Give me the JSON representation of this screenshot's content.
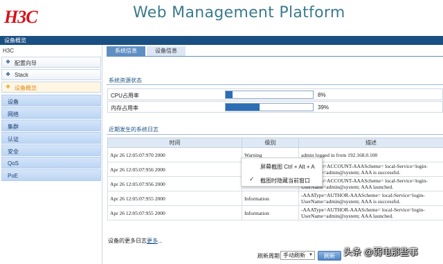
{
  "header": {
    "logo": "H3C",
    "platform_title": "Web Management Platform"
  },
  "topbar": {
    "label": "设备概览"
  },
  "sidebar": {
    "title": "H3C",
    "items": [
      {
        "label": "配置向导",
        "icon": "diamond-icon"
      },
      {
        "label": "Stack",
        "icon": "diamond-icon"
      },
      {
        "label": "设备概览",
        "icon": "diamond-icon"
      }
    ],
    "categories": [
      "设备",
      "网络",
      "集群",
      "认证",
      "安全",
      "QoS",
      "PoE"
    ]
  },
  "tabs": [
    "系统信息",
    "设备信息"
  ],
  "resources": {
    "title": "系统资源状态",
    "rows": [
      {
        "label": "CPU占用率",
        "percent": 8,
        "text": "8%"
      },
      {
        "label": "内存占用率",
        "percent": 39,
        "text": "39%"
      }
    ]
  },
  "log": {
    "title": "近期发生的系统日志",
    "headers": [
      "时间",
      "级别",
      "描述"
    ],
    "rows": [
      {
        "time": "Apr 26 12:05:07:970 2000",
        "level": "Warning",
        "desc": "admin logged in from 192.168.0.100"
      },
      {
        "time": "Apr 26 12:05:07:956 2000",
        "level": "",
        "desc": "-AAAType=ACCOUNT-AAAScheme= local-Service=login-\nUserName=admin@system; AAA is successful."
      },
      {
        "time": "Apr 26 12:05:07:956 2000",
        "level": "",
        "desc": "-AAAType=ACCOUNT-AAAScheme= local-Service=login-\nUserName=admin@system; AAA launched."
      },
      {
        "time": "Apr 26 12:05:07:955 2000",
        "level": "Information",
        "desc": "-AAAType=AUTHOR-AAAScheme= local-Service=login-\nUserName=admin@system; AAA is successful."
      },
      {
        "time": "Apr 26 12:05:07:955 2000",
        "level": "Information",
        "desc": "-AAAType=AUTHOR-AAAScheme= local-Service=login-\nUserName=admin@system; AAA launched."
      }
    ]
  },
  "footer": {
    "more_prefix": "设备的更多日志",
    "more_link": "更多",
    "more_suffix": "...",
    "refresh_label": "刷新周期",
    "refresh_value": "手动刷新",
    "refresh_button": "刷新"
  },
  "context_menu": {
    "items": [
      "屏幕截图 Ctrl + Alt + A",
      "截图时隐藏当前窗口"
    ]
  },
  "watermark": "头条 @弱电那些事"
}
